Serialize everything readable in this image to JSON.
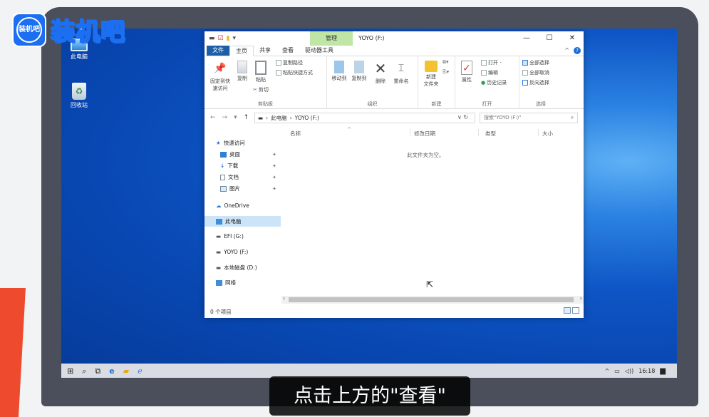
{
  "logo": {
    "badge_text": "装机吧",
    "wordmark": "装机吧"
  },
  "desktop": {
    "icons": [
      {
        "label": "此电脑"
      },
      {
        "label": "回收站"
      }
    ]
  },
  "explorer": {
    "title": "YOYO (F:)",
    "context_tab": "管理",
    "tabs": [
      "文件",
      "主页",
      "共享",
      "查看",
      "驱动器工具"
    ],
    "ribbon": {
      "clipboard": {
        "pin": "固定到快\n速访问",
        "copy": "复制",
        "paste": "粘贴",
        "copy_path": "复制路径",
        "paste_shortcut": "粘贴快捷方式",
        "cut": "剪切",
        "label": "剪贴板"
      },
      "organize": {
        "move_to": "移动到",
        "copy_to": "复制到",
        "delete": "删除",
        "rename": "重命名",
        "label": "组织"
      },
      "new": {
        "new_folder": "新建\n文件夹",
        "label": "新建"
      },
      "open": {
        "properties": "属性",
        "open": "打开 ·",
        "edit": "编辑",
        "history": "历史记录",
        "label": "打开"
      },
      "select": {
        "select_all": "全部选择",
        "select_none": "全部取消",
        "invert": "反向选择",
        "label": "选择"
      }
    },
    "address": {
      "root": "此电脑",
      "sep": "›",
      "current": "YOYO (F:)"
    },
    "search_placeholder": "搜索\"YOYO (F:)\"",
    "nav_pane": {
      "quick_access": "快速访问",
      "desktop": "桌面",
      "downloads": "下载",
      "documents": "文档",
      "pictures": "图片",
      "onedrive": "OneDrive",
      "this_pc": "此电脑",
      "efi": "EFI (G:)",
      "yoyo": "YOYO (F:)",
      "local_disk": "本地磁盘 (D:)",
      "network": "网络"
    },
    "columns": [
      "名称",
      "修改日期",
      "类型",
      "大小"
    ],
    "empty_text": "此文件夹为空。",
    "status_count": "0 个项目"
  },
  "taskbar": {
    "clock": "16:18",
    "tray_volume": "◁))",
    "tray_arrow": "^"
  },
  "caption": "点击上方的\"查看\""
}
